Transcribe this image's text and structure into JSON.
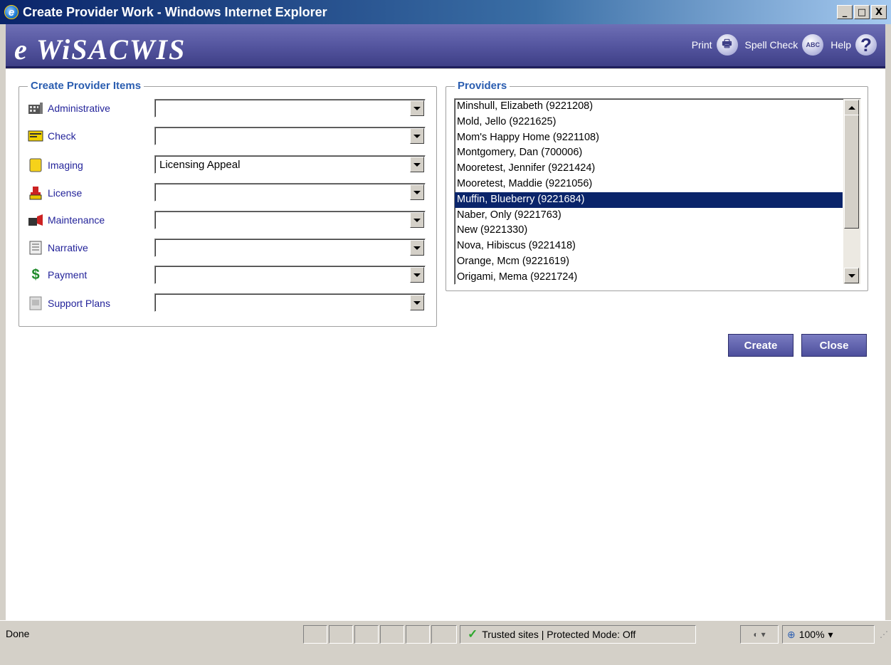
{
  "window": {
    "title": "Create Provider Work - Windows Internet Explorer",
    "minimize": "_",
    "maximize": "□",
    "close": "X"
  },
  "app": {
    "logo": "e WiSACWIS",
    "tools": [
      {
        "label": "Print",
        "icon": "printer-icon",
        "glyph": "🖶"
      },
      {
        "label": "Spell Check",
        "icon": "spell-check-icon",
        "glyph": "ABC"
      },
      {
        "label": "Help",
        "icon": "help-icon",
        "glyph": "?"
      }
    ]
  },
  "items_panel": {
    "legend": "Create Provider Items",
    "items": [
      {
        "label": "Administrative",
        "icon": "building-icon",
        "value": ""
      },
      {
        "label": "Check",
        "icon": "check-card-icon",
        "value": ""
      },
      {
        "label": "Imaging",
        "icon": "document-icon",
        "value": "Licensing Appeal"
      },
      {
        "label": "License",
        "icon": "license-stamp-icon",
        "value": ""
      },
      {
        "label": "Maintenance",
        "icon": "maintenance-icon",
        "value": ""
      },
      {
        "label": "Narrative",
        "icon": "narrative-icon",
        "value": ""
      },
      {
        "label": "Payment",
        "icon": "dollar-icon",
        "value": ""
      },
      {
        "label": "Support Plans",
        "icon": "support-plans-icon",
        "value": ""
      }
    ]
  },
  "providers_panel": {
    "legend": "Providers",
    "items": [
      "Minshull, Elizabeth (9221208)",
      "Mold, Jello (9221625)",
      "Mom's Happy Home (9221108)",
      "Montgomery, Dan (700006)",
      "Mooretest, Jennifer (9221424)",
      "Mooretest, Maddie (9221056)",
      "Muffin, Blueberry (9221684)",
      "Naber, Only (9221763)",
      "New (9221330)",
      "Nova, Hibiscus (9221418)",
      "Orange, Mcm (9221619)",
      "Origami, Mema (9221724)"
    ],
    "selected": "Muffin, Blueberry (9221684)"
  },
  "actions": {
    "create": "Create",
    "close": "Close"
  },
  "statusbar": {
    "status": "Done",
    "zone": "Trusted sites | Protected Mode: Off",
    "zoom": "100%"
  },
  "colors": {
    "banner": "#5556a0",
    "legend": "#2a5db0",
    "item_label": "#23239a",
    "selected_row": "#0a246a"
  }
}
